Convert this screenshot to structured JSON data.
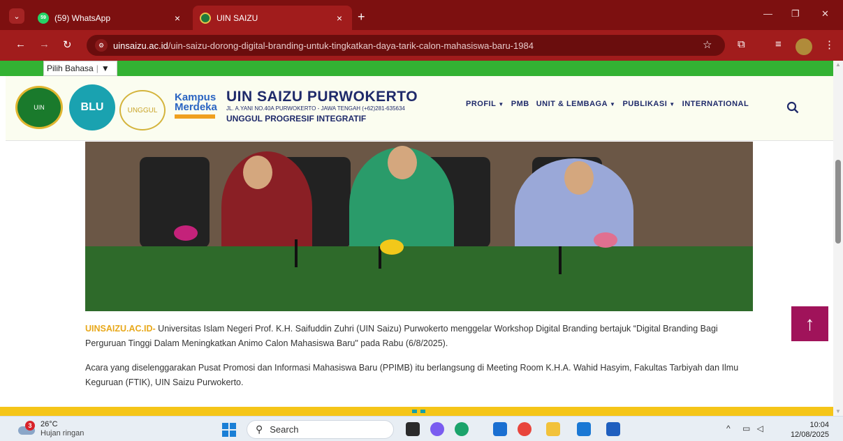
{
  "browser": {
    "tabs": [
      {
        "title": "(59) WhatsApp",
        "favicon": "whatsapp-icon",
        "favicon_text": "59",
        "active": false
      },
      {
        "title": "UIN SAIZU",
        "favicon": "uin-saizu-icon",
        "favicon_text": "",
        "active": true
      }
    ],
    "new_tab": "+",
    "tab_close": "×",
    "window_controls": {
      "minimize": "—",
      "restore": "❐",
      "close": "✕"
    },
    "url_domain": "uinsaizu.ac.id",
    "url_path": "/uin-saizu-dorong-digital-branding-untuk-tingkatkan-daya-tarik-calon-mahasiswa-baru-1984",
    "theme_color": "#a11c1c"
  },
  "page": {
    "language_select": "Pilih Bahasa",
    "language_caret": "▼",
    "site": {
      "name": "UIN SAIZU PURWOKERTO",
      "address": "JL. A.YANI NO.40A PURWOKERTO - JAWA TENGAH (+62)281-635634",
      "tagline": "UNGGUL PROGRESIF INTEGRATIF",
      "logos": {
        "uin": "UIN",
        "blu": "BLU",
        "unggul": "UNGGUL",
        "kampus_merdeka": "Kampus Merdeka"
      }
    },
    "nav": [
      {
        "label": "PROFIL",
        "dropdown": true
      },
      {
        "label": "PMB",
        "dropdown": false
      },
      {
        "label": "UNIT & LEMBAGA",
        "dropdown": true
      },
      {
        "label": "PUBLIKASI",
        "dropdown": true
      },
      {
        "label": "INTERNATIONAL",
        "dropdown": false
      }
    ],
    "article": {
      "source_label": "UINSAIZU.AC.ID-",
      "paragraph1": " Universitas Islam Negeri Prof. K.H. Saifuddin Zuhri (UIN Saizu) Purwokerto menggelar Workshop Digital Branding bertajuk “Digital Branding Bagi Perguruan Tinggi Dalam Meningkatkan Animo Calon Mahasiswa Baru\" pada Rabu (6/8/2025).",
      "paragraph2": "Acara yang diselenggarakan Pusat Promosi dan Informasi Mahasiswa Baru (PPIMB) itu berlangsung di Meeting Room K.H.A. Wahid Hasyim, Fakultas Tarbiyah dan Ilmu Keguruan (FTIK), UIN Saizu Purwokerto."
    },
    "scroll_top_icon": "↑",
    "colors": {
      "lang_bar": "#33b233",
      "header_bg": "#fbfdf0",
      "brand_navy": "#1f2a6a",
      "source_gold": "#e8a81a",
      "scroll_top": "#a0135a",
      "footer_bar": "#f5c518"
    }
  },
  "taskbar": {
    "weather": {
      "alerts": "3",
      "temp": "26°C",
      "condition": "Hujan ringan"
    },
    "search_placeholder": "Search",
    "apps": [
      "file-explorer-icon",
      "copilot-icon",
      "edge-icon",
      "store-icon",
      "chrome-icon",
      "folder-icon",
      "outlook-icon",
      "word-icon"
    ],
    "time": "10:04",
    "date": "12/08/2025"
  }
}
